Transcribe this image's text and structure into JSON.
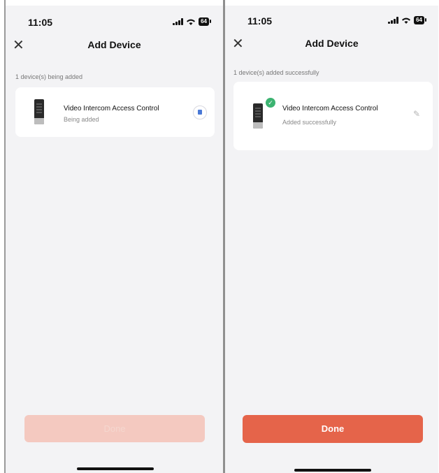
{
  "status_bar": {
    "time": "11:05",
    "battery": "64"
  },
  "screens": [
    {
      "title": "Add Device",
      "summary": "1 device(s) being added",
      "device": {
        "name": "Video Intercom Access Control",
        "status": "Being added"
      },
      "done_label": "Done",
      "done_state": "disabled"
    },
    {
      "title": "Add Device",
      "summary": "1 device(s) added successfully",
      "device": {
        "name": "Video Intercom Access Control",
        "status": "Added successfully"
      },
      "done_label": "Done",
      "done_state": "enabled"
    }
  ],
  "icons": {
    "close": "close-icon",
    "spinner": "loading-spinner-icon",
    "check": "check-badge-icon",
    "edit": "edit-pencil-icon",
    "signal": "signal-icon",
    "wifi": "wifi-icon",
    "battery": "battery-icon"
  },
  "colors": {
    "accent": "#e5644a",
    "accent_disabled": "#f4c9c0",
    "success": "#3cb371",
    "background": "#f3f3f5"
  }
}
